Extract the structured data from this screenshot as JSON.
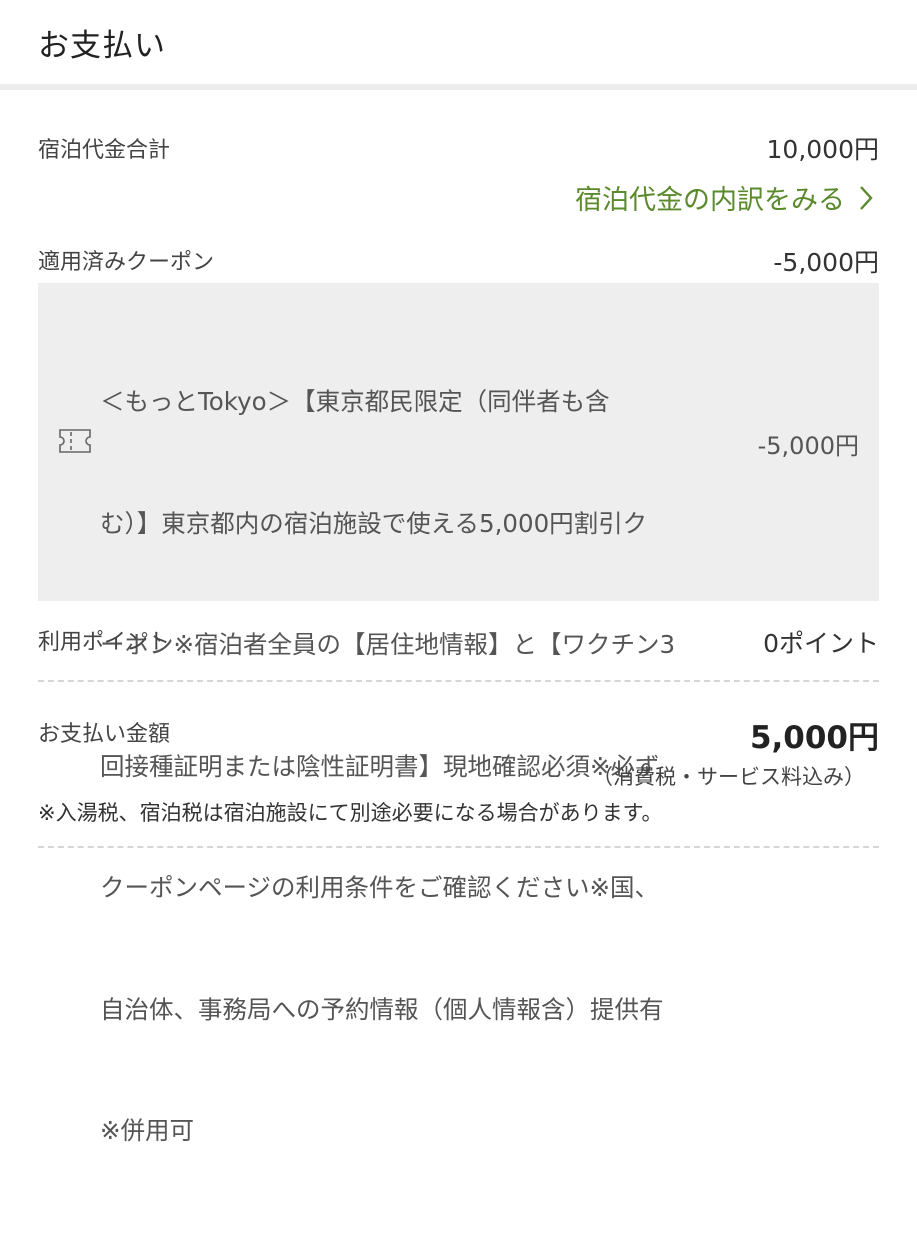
{
  "header": {
    "title": "お支払い"
  },
  "lodging": {
    "label": "宿泊代金合計",
    "value": "10,000円",
    "breakdown_link": "宿泊代金の内訳をみる"
  },
  "coupon": {
    "label": "適用済みクーポン",
    "value": "-5,000円",
    "detail_lines": [
      "＜もっとTokyo＞【東京都民限定（同伴者も含",
      "む）】東京都内の宿泊施設で使える5,000円割引ク",
      "ーポン※宿泊者全員の【居住地情報】と【ワクチン3",
      "回接種証明または陰性証明書】現地確認必須※必ず",
      "クーポンページの利用条件をご確認ください※国、",
      "自治体、事務局への予約情報（個人情報含）提供有",
      "※併用可"
    ],
    "detail_amount": "-5,000円",
    "icon": "coupon-ticket-icon"
  },
  "points": {
    "label": "利用ポイント",
    "value": "0ポイント"
  },
  "payment": {
    "label": "お支払い金額",
    "value": "5,000円",
    "tax_note": "（消費税・サービス料込み）",
    "footnote": "※入湯税、宿泊税は宿泊施設にて別途必要になる場合があります。"
  },
  "colors": {
    "link_green": "#5a8a2b",
    "coupon_bg": "#eeeeee",
    "divider": "#ededed"
  }
}
